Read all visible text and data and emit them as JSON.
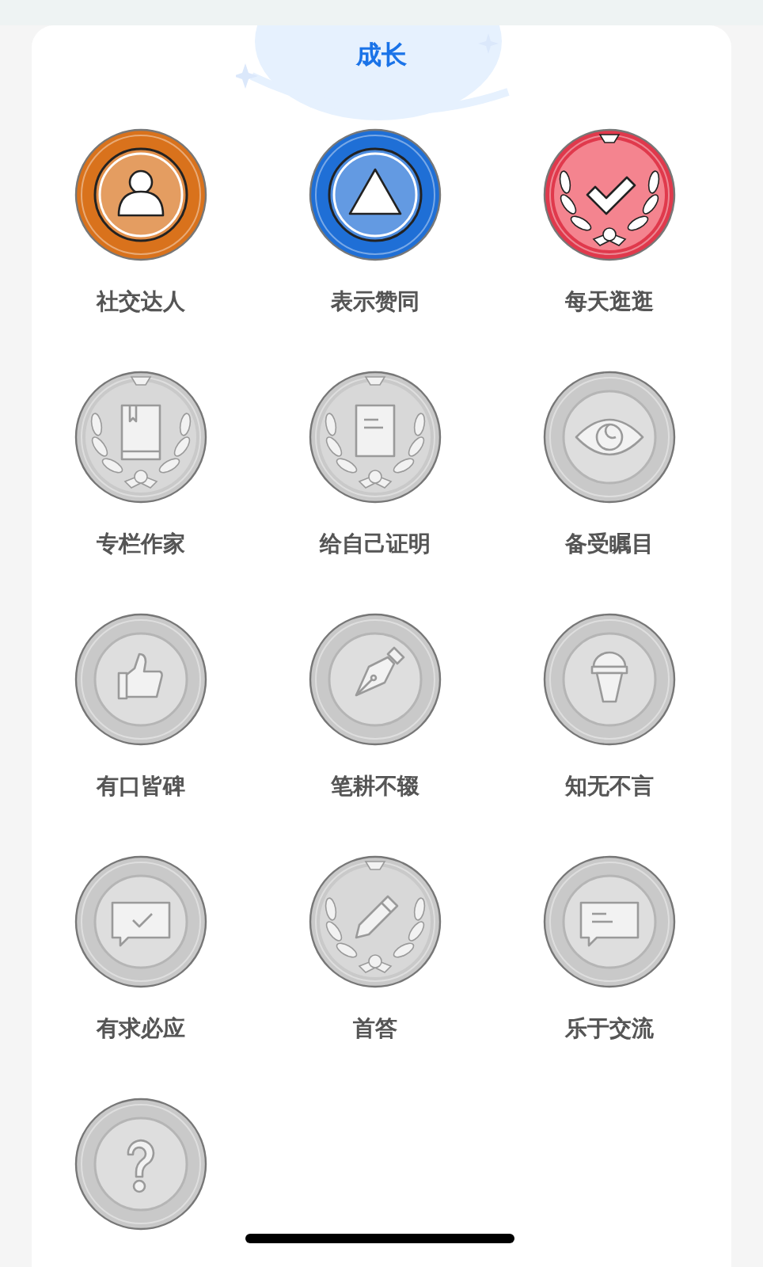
{
  "title": "成长",
  "badges": [
    {
      "label": "社交达人",
      "kind": "person",
      "earned": true,
      "color": "#d9721c",
      "laurel": false
    },
    {
      "label": "表示赞同",
      "kind": "triangle",
      "earned": true,
      "color": "#1f6fd6",
      "laurel": false
    },
    {
      "label": "每天逛逛",
      "kind": "check",
      "earned": true,
      "color": "#e0394c",
      "laurel": true
    },
    {
      "label": "专栏作家",
      "kind": "book",
      "earned": false,
      "laurel": true
    },
    {
      "label": "给自己证明",
      "kind": "document",
      "earned": false,
      "laurel": true
    },
    {
      "label": "备受瞩目",
      "kind": "eye",
      "earned": false,
      "laurel": false
    },
    {
      "label": "有口皆碑",
      "kind": "thumb",
      "earned": false,
      "laurel": false
    },
    {
      "label": "笔耕不辍",
      "kind": "pen",
      "earned": false,
      "laurel": false
    },
    {
      "label": "知无不言",
      "kind": "microphone",
      "earned": false,
      "laurel": false
    },
    {
      "label": "有求必应",
      "kind": "chat-check",
      "earned": false,
      "laurel": false
    },
    {
      "label": "首答",
      "kind": "pencil",
      "earned": false,
      "laurel": true
    },
    {
      "label": "乐于交流",
      "kind": "chat-lines",
      "earned": false,
      "laurel": false
    },
    {
      "kind": "question",
      "earned": false,
      "laurel": false
    }
  ]
}
